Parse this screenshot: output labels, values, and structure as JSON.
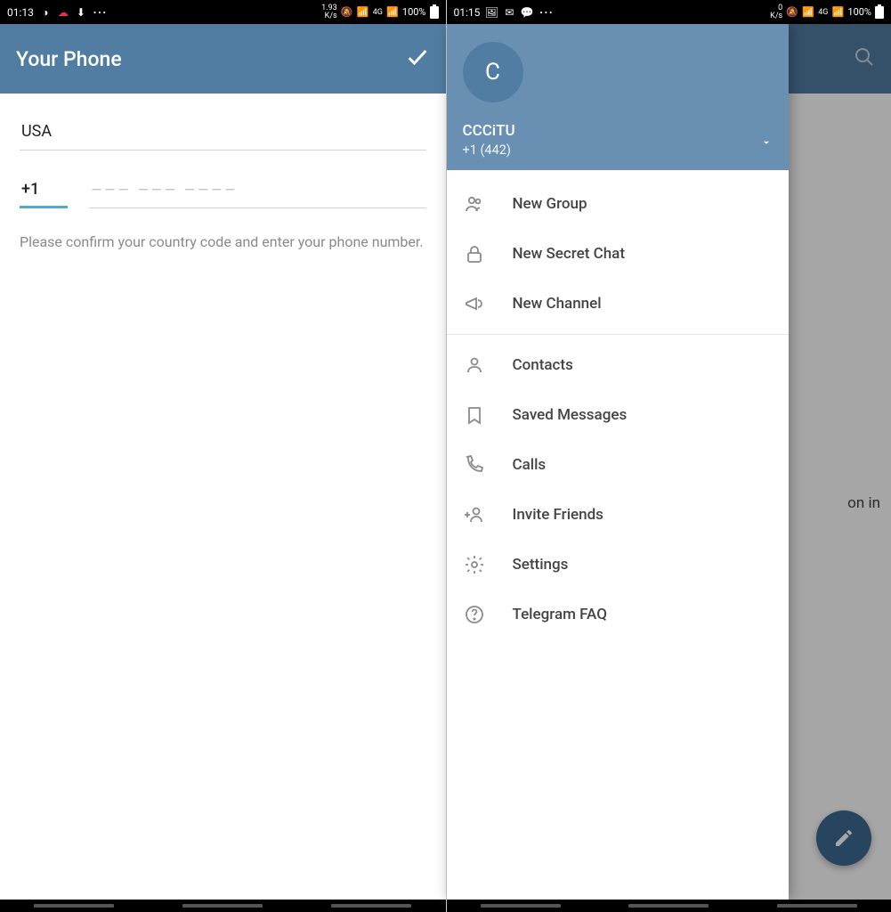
{
  "left": {
    "statusbar": {
      "time": "01:13",
      "ks": "1.93\nK/s",
      "net": "4G",
      "battery_pct": "100%"
    },
    "header": {
      "title": "Your Phone"
    },
    "form": {
      "country": "USA",
      "code": "+1",
      "placeholder": "–––  –––  ––––",
      "instruction": "Please confirm your country code and enter your phone number."
    }
  },
  "right": {
    "statusbar": {
      "time": "01:15",
      "ks": "0\nK/s",
      "net": "4G",
      "battery_pct": "100%"
    },
    "bg_text": "on in",
    "drawer": {
      "avatar_initial": "C",
      "username": "CCCiTU",
      "phone": "+1 (442)",
      "items_a": [
        {
          "key": "new-group",
          "label": "New Group"
        },
        {
          "key": "new-secret-chat",
          "label": "New Secret Chat"
        },
        {
          "key": "new-channel",
          "label": "New Channel"
        }
      ],
      "items_b": [
        {
          "key": "contacts",
          "label": "Contacts"
        },
        {
          "key": "saved-messages",
          "label": "Saved Messages"
        },
        {
          "key": "calls",
          "label": "Calls"
        },
        {
          "key": "invite-friends",
          "label": "Invite Friends"
        },
        {
          "key": "settings",
          "label": "Settings"
        },
        {
          "key": "telegram-faq",
          "label": "Telegram FAQ"
        }
      ]
    }
  }
}
